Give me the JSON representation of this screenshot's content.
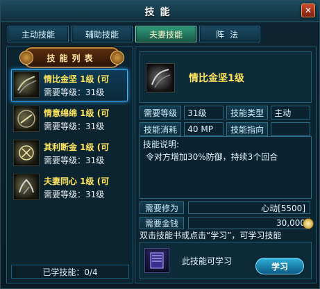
{
  "window": {
    "title": "技能"
  },
  "tabs": [
    {
      "label": "主动技能",
      "active": false
    },
    {
      "label": "辅助技能",
      "active": false
    },
    {
      "label": "夫妻技能",
      "active": true
    },
    {
      "label": "阵法",
      "active": false
    }
  ],
  "skill_list": {
    "title": "技能列表",
    "items": [
      {
        "name": "情比金坚 1级 (可",
        "level": "需要等级：31级",
        "selected": true
      },
      {
        "name": "情意绵绵 1级 (可",
        "level": "需要等级：31级",
        "selected": false
      },
      {
        "name": "其利断金 1级 (可",
        "level": "需要等级：31级",
        "selected": false
      },
      {
        "name": "夫妻同心 1级 (可",
        "level": "需要等级：31级",
        "selected": false
      }
    ],
    "learned": "已学技能：0/4"
  },
  "detail": {
    "title": "情比金坚1级",
    "required_level_label": "需要等级",
    "required_level_value": "31级",
    "skill_type_label": "技能类型",
    "skill_type_value": "主动",
    "cost_label": "技能消耗",
    "cost_value": "40 MP",
    "target_label": "技能指向",
    "target_value": "",
    "desc_label": "技能说明:",
    "desc_text": "令对方增加30%防御，持续3个回合",
    "req_bond_label": "需要修为",
    "req_bond_value": "心动[5500]",
    "req_money_label": "需要金钱",
    "req_money_value": "30,000",
    "hint": "双击技能书或点击“学习”，可学习技能",
    "can_learn": "此技能可学习",
    "learn_button": "学习"
  },
  "colors": {
    "accent_yellow": "#ffe45c",
    "tab_active": "#2e9a7a",
    "selection_blue": "#3fb4ff"
  }
}
